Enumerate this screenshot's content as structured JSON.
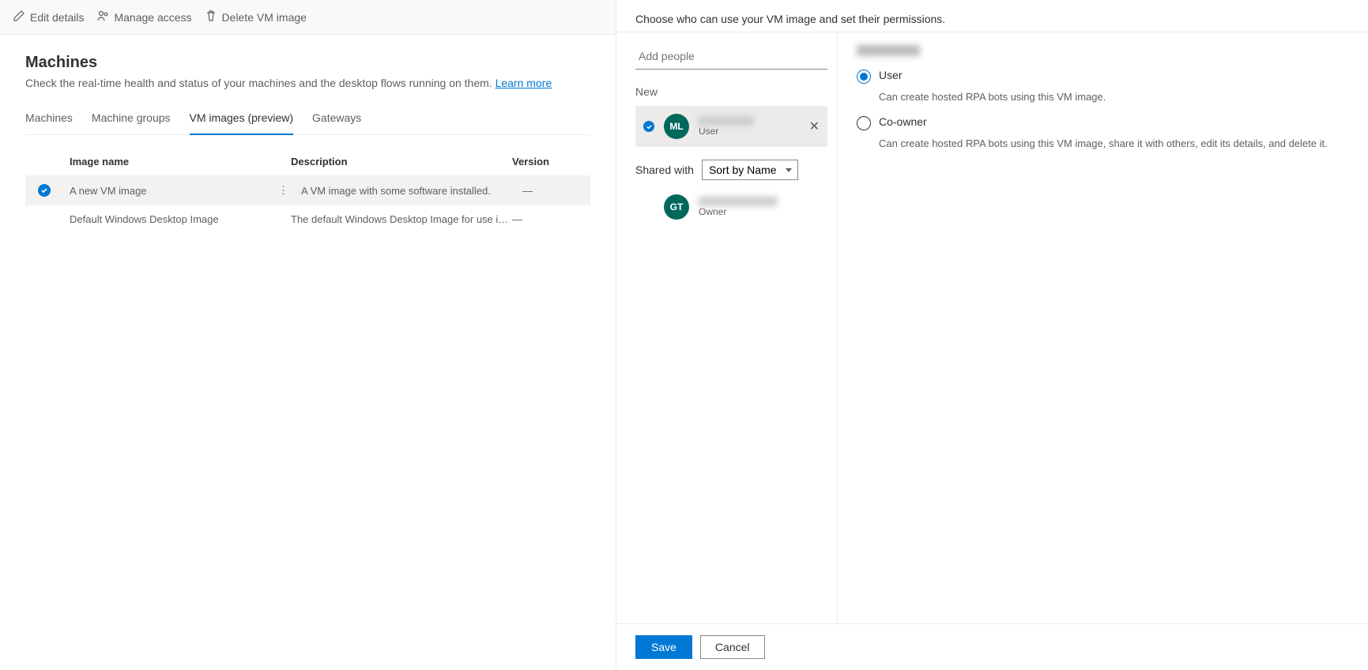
{
  "toolbar": {
    "edit_label": "Edit details",
    "manage_label": "Manage access",
    "delete_label": "Delete VM image"
  },
  "page": {
    "title": "Machines",
    "subtitle_prefix": "Check the real-time health and status of your machines and the desktop flows running on them. ",
    "learn_more": "Learn more"
  },
  "tabs": [
    {
      "label": "Machines",
      "active": false
    },
    {
      "label": "Machine groups",
      "active": false
    },
    {
      "label": "VM images (preview)",
      "active": true
    },
    {
      "label": "Gateways",
      "active": false
    }
  ],
  "table": {
    "headers": {
      "name": "Image name",
      "description": "Description",
      "version": "Version"
    },
    "rows": [
      {
        "selected": true,
        "name": "A new VM image",
        "description": "A VM image with some software installed.",
        "version": "—"
      },
      {
        "selected": false,
        "name": "Default Windows Desktop Image",
        "description": "The default Windows Desktop Image for use in the Product ...",
        "version": "—"
      }
    ]
  },
  "panel": {
    "description": "Choose who can use your VM image and set their permissions.",
    "search_placeholder": "Add people",
    "new_label": "New",
    "new_person": {
      "initials": "ML",
      "role": "User"
    },
    "shared_label": "Shared with",
    "sort_value": "Sort by Name",
    "shared_person": {
      "initials": "GT",
      "role": "Owner"
    },
    "permissions": {
      "user": {
        "label": "User",
        "desc": "Can create hosted RPA bots using this VM image."
      },
      "coowner": {
        "label": "Co-owner",
        "desc": "Can create hosted RPA bots using this VM image, share it with others, edit its details, and delete it."
      }
    },
    "save": "Save",
    "cancel": "Cancel"
  }
}
